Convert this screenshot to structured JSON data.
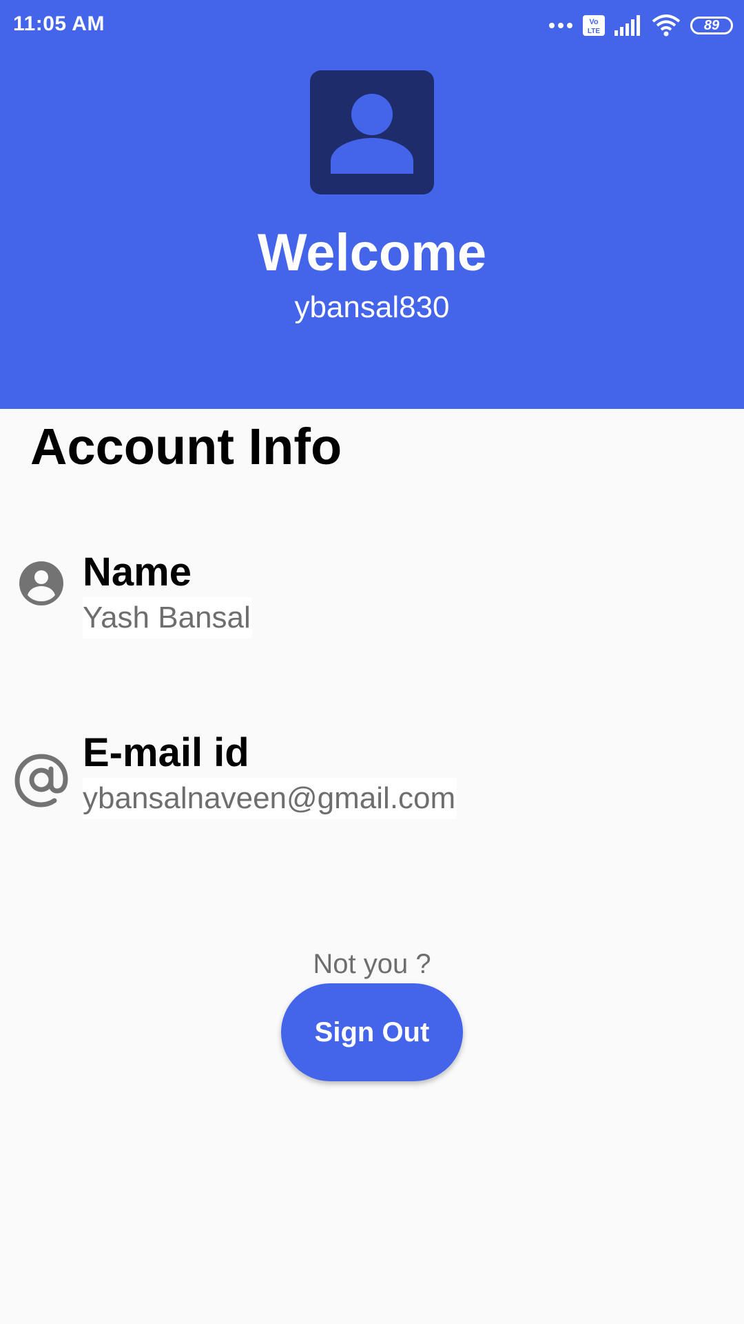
{
  "status_bar": {
    "time": "11:05 AM",
    "battery": "89",
    "icons": [
      "more-dots-icon",
      "volte-icon",
      "signal-icon",
      "wifi-icon",
      "battery-icon"
    ]
  },
  "header": {
    "avatar_icon": "person-icon",
    "title": "Welcome",
    "username": "ybansal830",
    "background_color": "#4465ea",
    "avatar_color": "#1e2c6b"
  },
  "account": {
    "title": "Account Info",
    "name": {
      "icon": "account-circle-icon",
      "label": "Name",
      "value": "Yash Bansal"
    },
    "email": {
      "icon": "at-sign-icon",
      "label": "E-mail id",
      "value": "ybansalnaveen@gmail.com"
    }
  },
  "footer": {
    "prompt": "Not you ?",
    "sign_out_label": "Sign Out"
  }
}
